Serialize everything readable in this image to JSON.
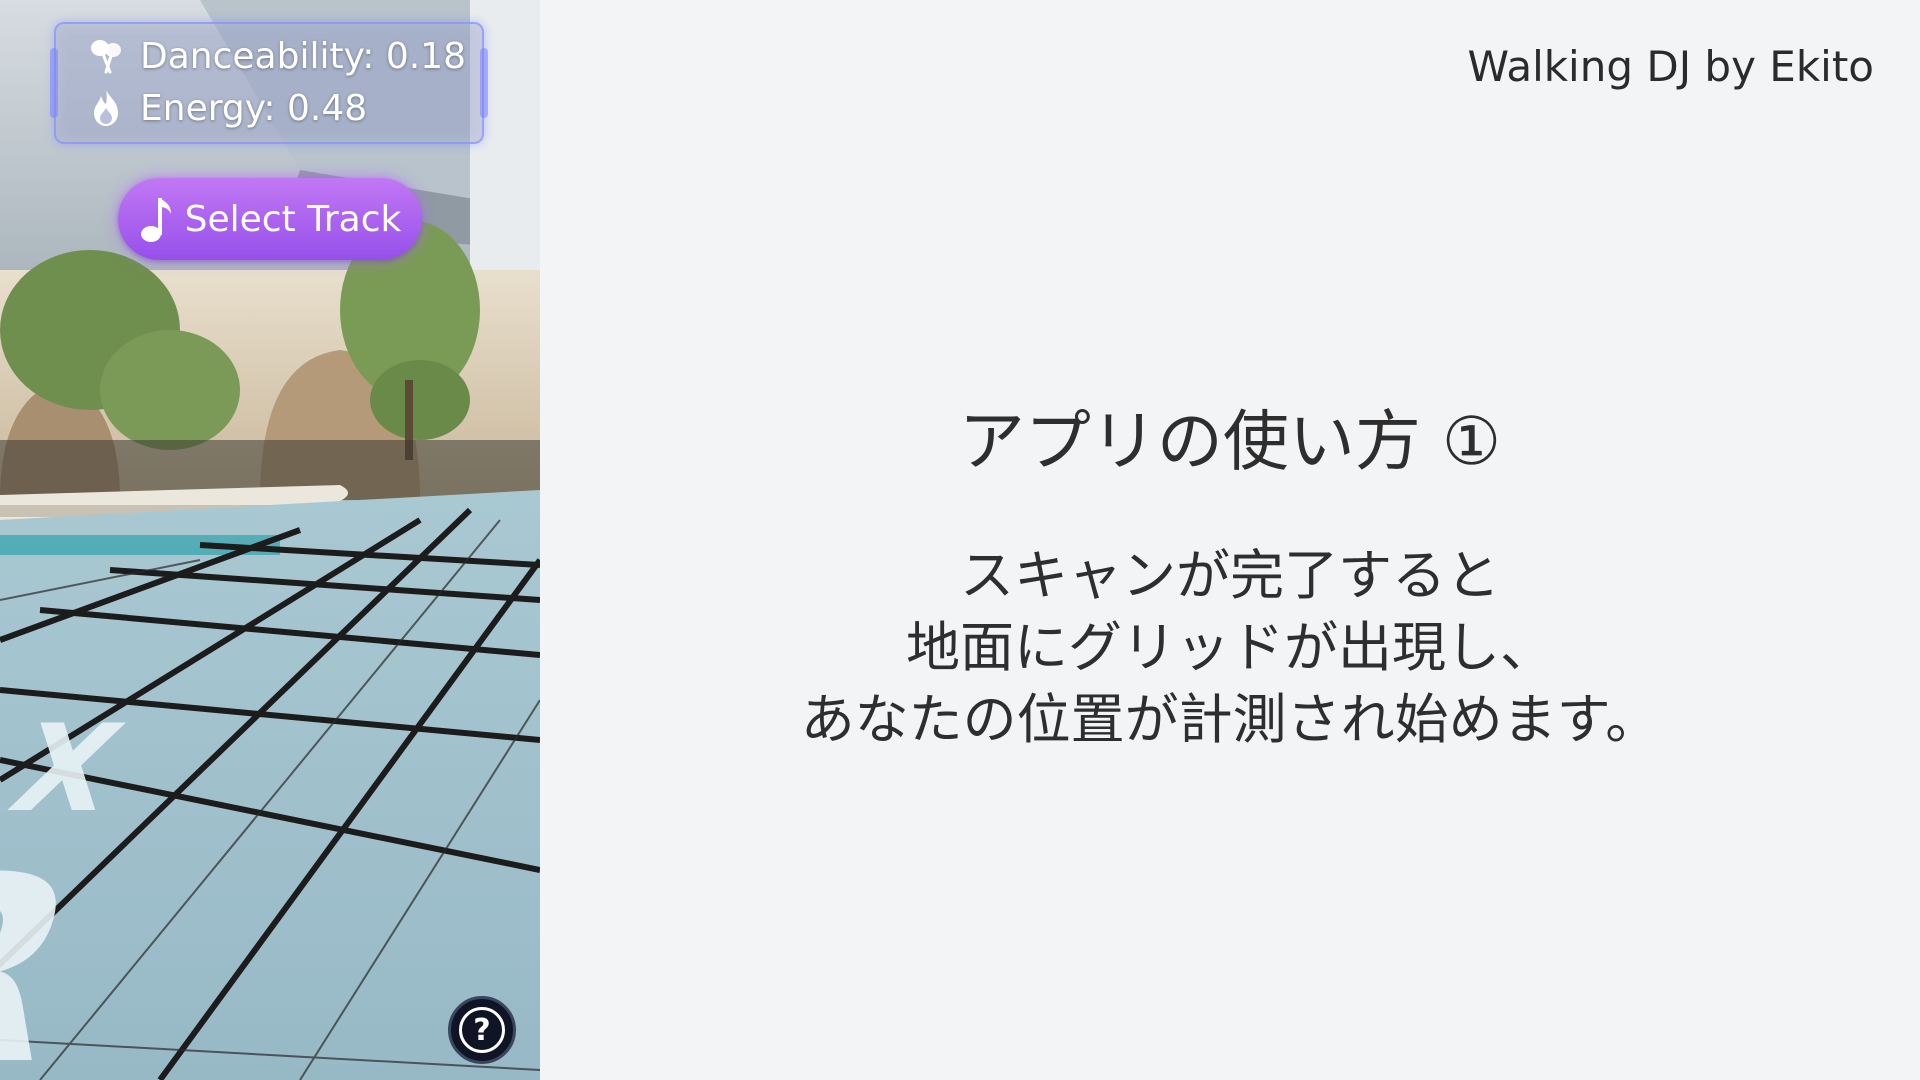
{
  "app": {
    "brand": "Walking DJ by Ekito"
  },
  "ar_view": {
    "stats": {
      "danceability_label": "Danceability: 0.18",
      "energy_label": "Energy: 0.48",
      "danceability_icon": "maracas-icon",
      "energy_icon": "flame-icon"
    },
    "select_track": {
      "label": "Select Track",
      "icon": "music-note-icon"
    },
    "help": {
      "label": "?",
      "icon": "help-icon"
    },
    "floor_text": "AR"
  },
  "slide": {
    "title": "アプリの使い方 ①",
    "lines": [
      "スキャンが完了すると",
      "地面にグリッドが出現し、",
      "あなたの位置が計測され始めます。"
    ]
  },
  "colors": {
    "accent_purple": "#9650ea",
    "background": "#f3f4f6",
    "text": "#2e2e2e"
  }
}
